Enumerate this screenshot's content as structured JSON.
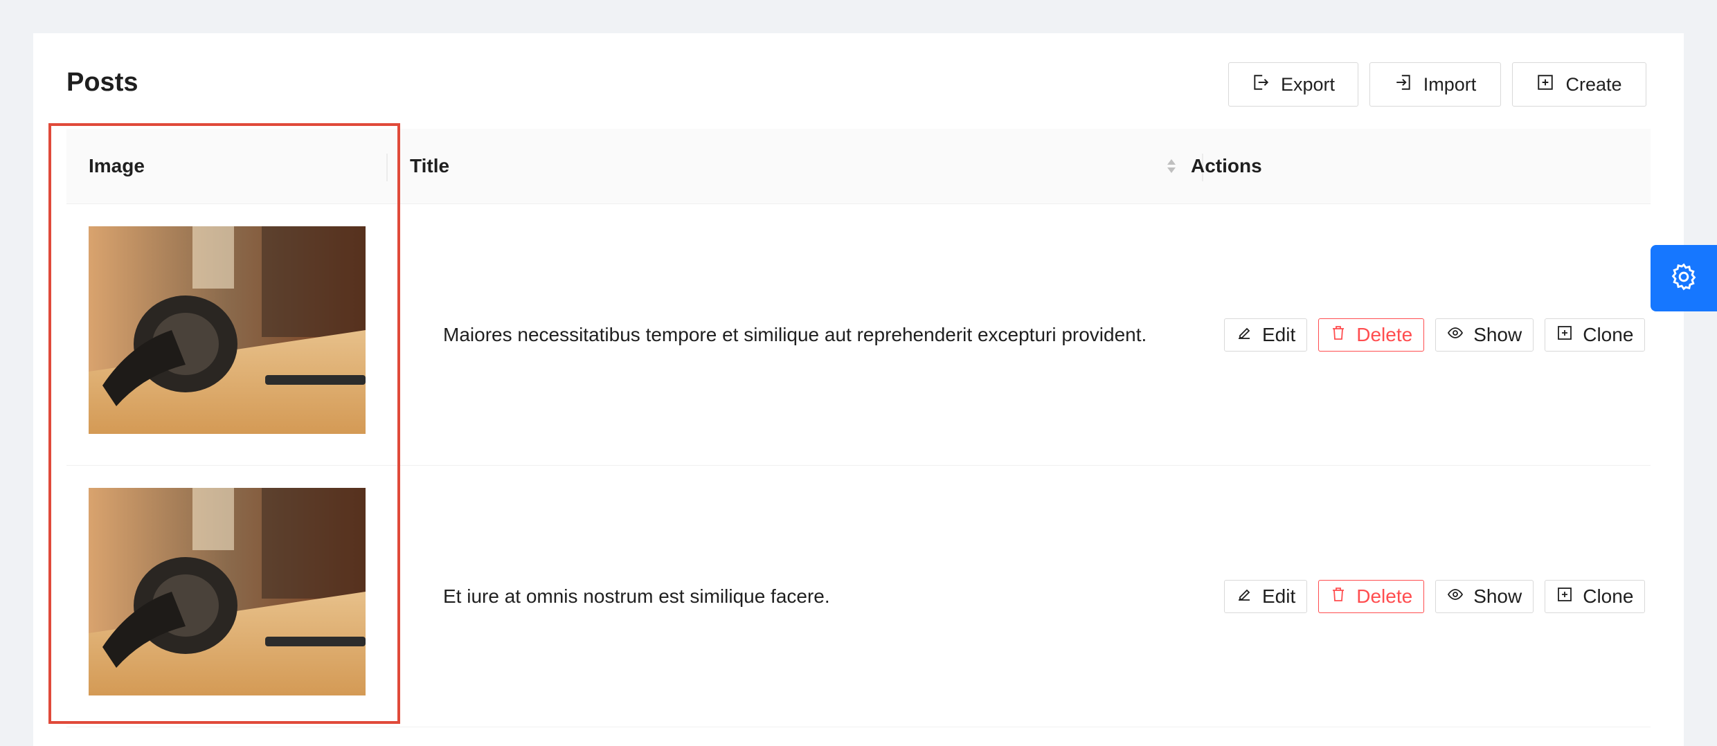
{
  "page": {
    "title": "Posts"
  },
  "header_buttons": {
    "export": "Export",
    "import": "Import",
    "create": "Create"
  },
  "table": {
    "columns": [
      "Image",
      "Title",
      "Actions"
    ],
    "rows": [
      {
        "title": "Maiores necessitatibus tempore et similique aut reprehenderit excepturi provident."
      },
      {
        "title": "Et iure at omnis nostrum est similique facere."
      }
    ]
  },
  "row_actions": {
    "edit": "Edit",
    "delete": "Delete",
    "show": "Show",
    "clone": "Clone"
  },
  "icons": {
    "export": "export-icon",
    "import": "import-icon",
    "create": "plus-square-icon",
    "edit": "edit-icon",
    "delete": "delete-icon",
    "show": "eye-icon",
    "clone": "plus-square-icon",
    "settings": "gear-icon",
    "sort": "sort-icon"
  },
  "colors": {
    "accent": "#1677ff",
    "danger": "#ff4d4f",
    "highlight": "#e04a3a"
  }
}
